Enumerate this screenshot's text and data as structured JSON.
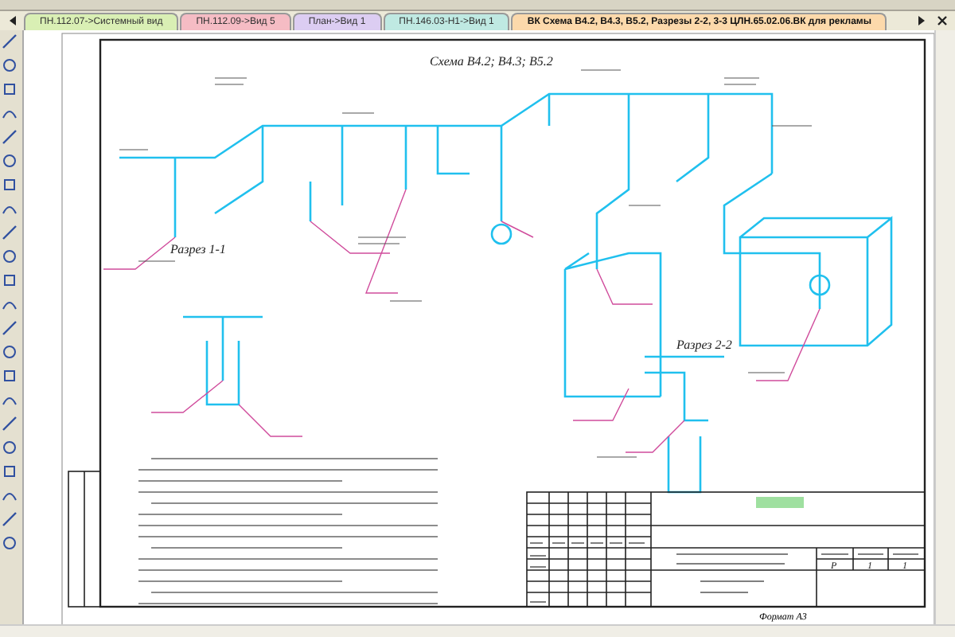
{
  "tabs": [
    {
      "label": "ПН.112.07->Системный вид",
      "selected": false,
      "color": "#d9efb4"
    },
    {
      "label": "ПН.112.09->Вид 5",
      "selected": false,
      "color": "#f5bcc4"
    },
    {
      "label": "План->Вид 1",
      "selected": false,
      "color": "#dccdf2"
    },
    {
      "label": "ПН.146.03-Н1->Вид 1",
      "selected": false,
      "color": "#bfe9e2"
    },
    {
      "label": "ВК Схема В4.2, В4.3, В5.2, Разрезы 2-2, 3-3 ЦЛН.65.02.06.ВК для рекламы",
      "selected": true,
      "color": "#fcd9ab"
    }
  ],
  "drawing": {
    "scheme_title": "Схема В4.2; В4.3; В5.2",
    "section_1": "Разрез 1-1",
    "section_2": "Разрез 2-2"
  },
  "title_block": {
    "values": [
      "Р",
      "1",
      "1"
    ]
  },
  "format": "Формат А3"
}
